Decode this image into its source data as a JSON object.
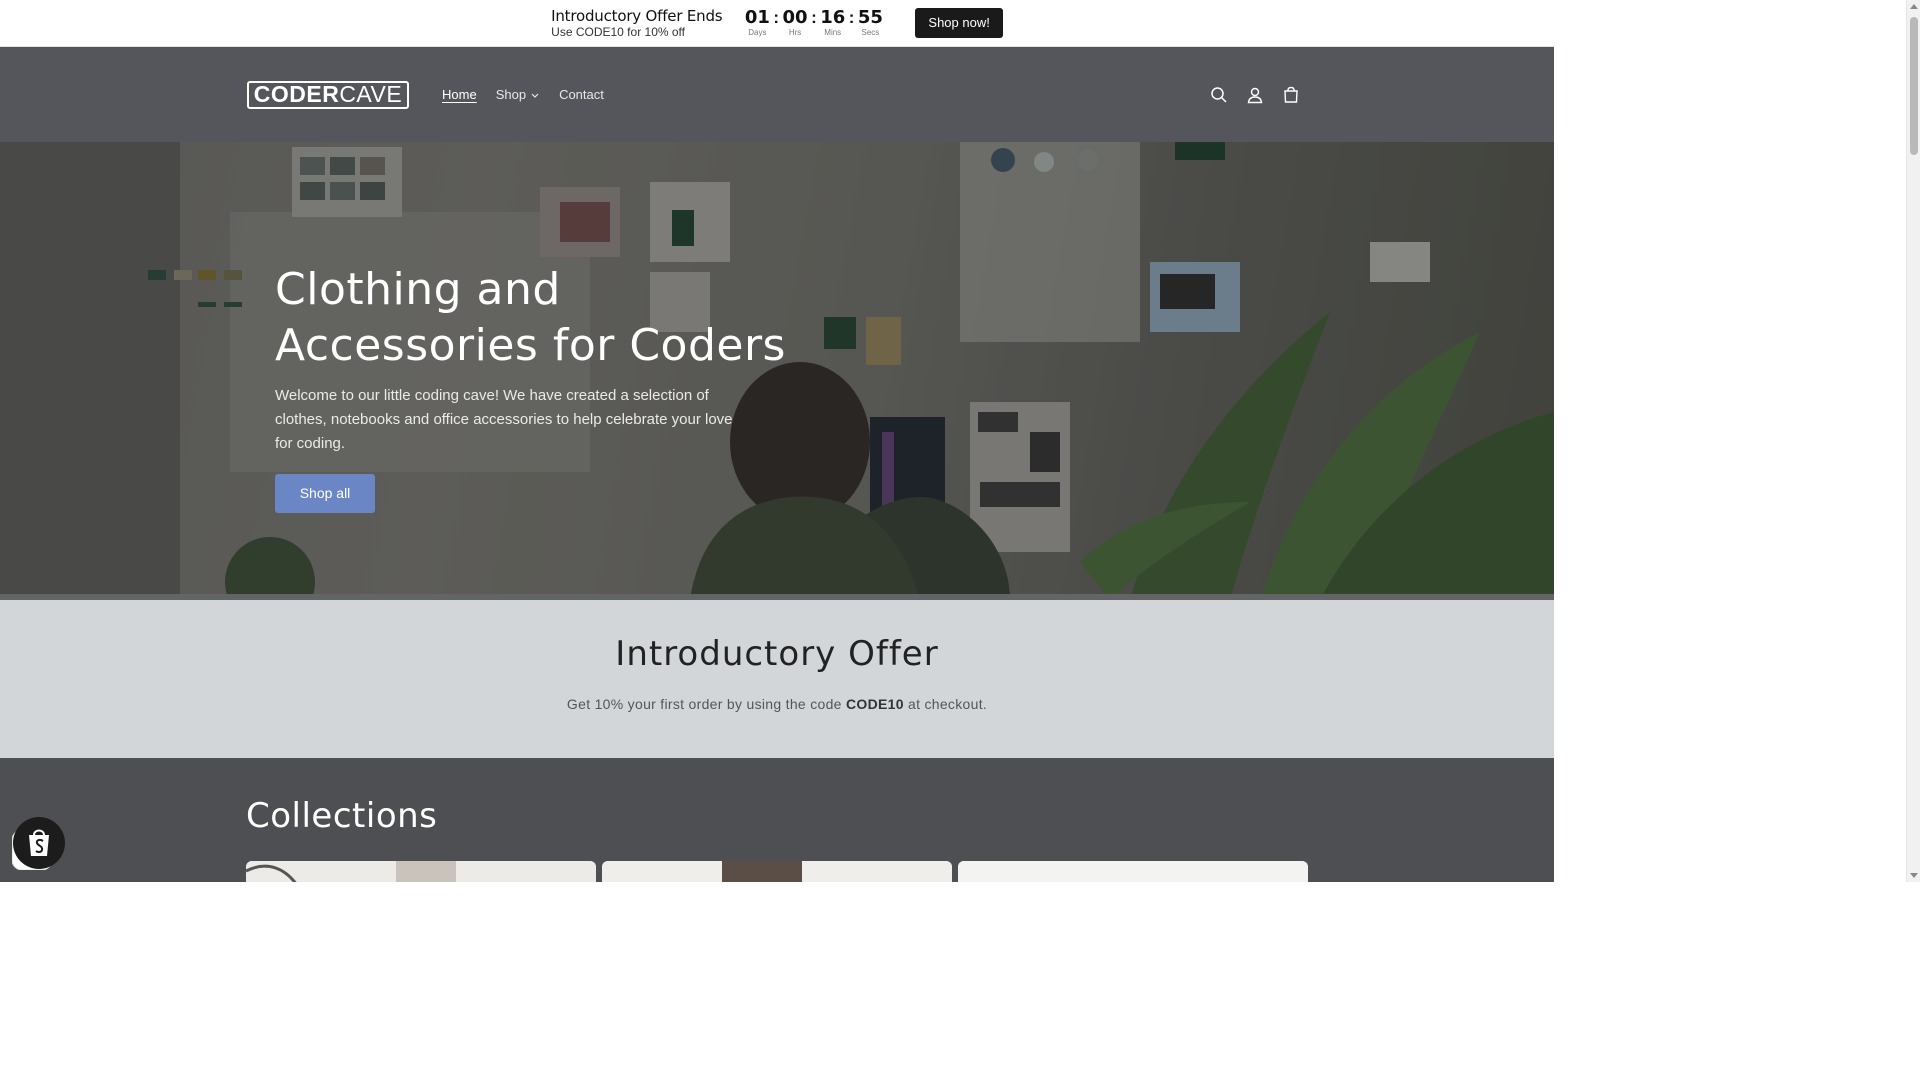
{
  "announcement": {
    "title": "Introductory Offer Ends",
    "subtitle": "Use CODE10 for 10% off",
    "countdown": [
      {
        "value": "01",
        "label": "Days"
      },
      {
        "value": "00",
        "label": "Hrs"
      },
      {
        "value": "16",
        "label": "Mins"
      },
      {
        "value": "55",
        "label": "Secs"
      }
    ],
    "separator": ":",
    "button_label": "Shop now!"
  },
  "header": {
    "logo_bold": "CODER",
    "logo_thin": "CAVE",
    "nav": [
      {
        "label": "Home",
        "active": true
      },
      {
        "label": "Shop",
        "has_dropdown": true
      },
      {
        "label": "Contact"
      }
    ],
    "icons": [
      "search-icon",
      "account-icon",
      "cart-icon"
    ]
  },
  "hero": {
    "title": "Clothing and Accessories for Coders",
    "text": "Welcome to our little coding cave! We have created a selection of clothes, notebooks and office accessories to help celebrate your love for coding.",
    "button_label": "Shop all"
  },
  "offer": {
    "heading": "Introductory Offer",
    "desc_before": "Get 10% your first order by using the code ",
    "code": "CODE10",
    "desc_after": " at checkout."
  },
  "collections": {
    "heading": "Collections"
  },
  "colors": {
    "header_bg": "#54565b",
    "accent": "#6a86c5",
    "offer_bg": "#d3d6d9",
    "collections_bg": "#4d4f53"
  }
}
